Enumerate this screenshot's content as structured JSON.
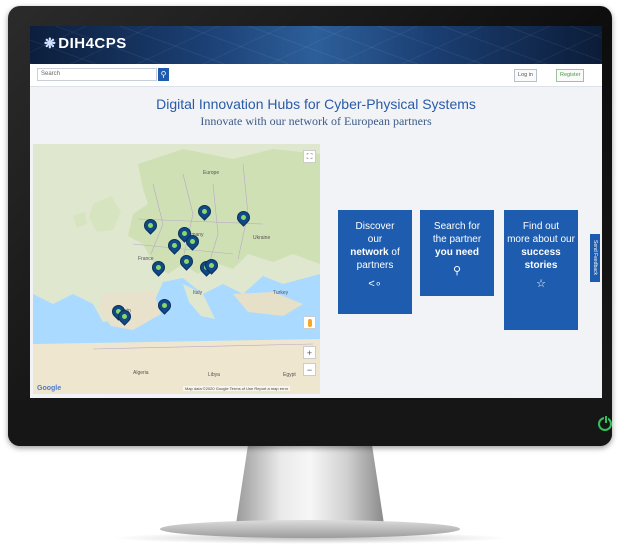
{
  "header": {
    "logo_text": "DIH4CPS"
  },
  "navbar": {
    "search_placeholder": "Search",
    "search_icon": "search-icon",
    "login_label": "Log in",
    "register_label": "Register"
  },
  "hero": {
    "title": "Digital Innovation Hubs for Cyber-Physical Systems",
    "subtitle": "Innovate with our network of European partners"
  },
  "map": {
    "labels": [
      "Europe",
      "Ukraine",
      "Spain",
      "Italy",
      "Algeria",
      "Libya",
      "Egypt",
      "Turkey",
      "Germany",
      "France"
    ],
    "attribution": "Google",
    "footer_text": "Map data ©2020 Google  Terms of Use  Report a map error",
    "zoom_in": "+",
    "zoom_out": "−",
    "fullscreen": "⛶",
    "pin_count": 13
  },
  "cards": [
    {
      "line1": "Discover",
      "line2": "our",
      "bold": "network",
      "line3": "of partners",
      "icon": "share-icon",
      "glyph": "⋖"
    },
    {
      "line1": "Search for",
      "line2": "the partner",
      "bold": "you need",
      "line3": "",
      "icon": "search-icon",
      "glyph": "⚲"
    },
    {
      "line1": "Find out",
      "line2": "more about our",
      "bold": "success stories",
      "line3": "",
      "icon": "star-icon",
      "glyph": "☆"
    }
  ],
  "feedback_tab": "Send Feedback",
  "colors": {
    "accent": "#1d5cae",
    "title": "#2a5aa8",
    "power": "#34c05a"
  }
}
